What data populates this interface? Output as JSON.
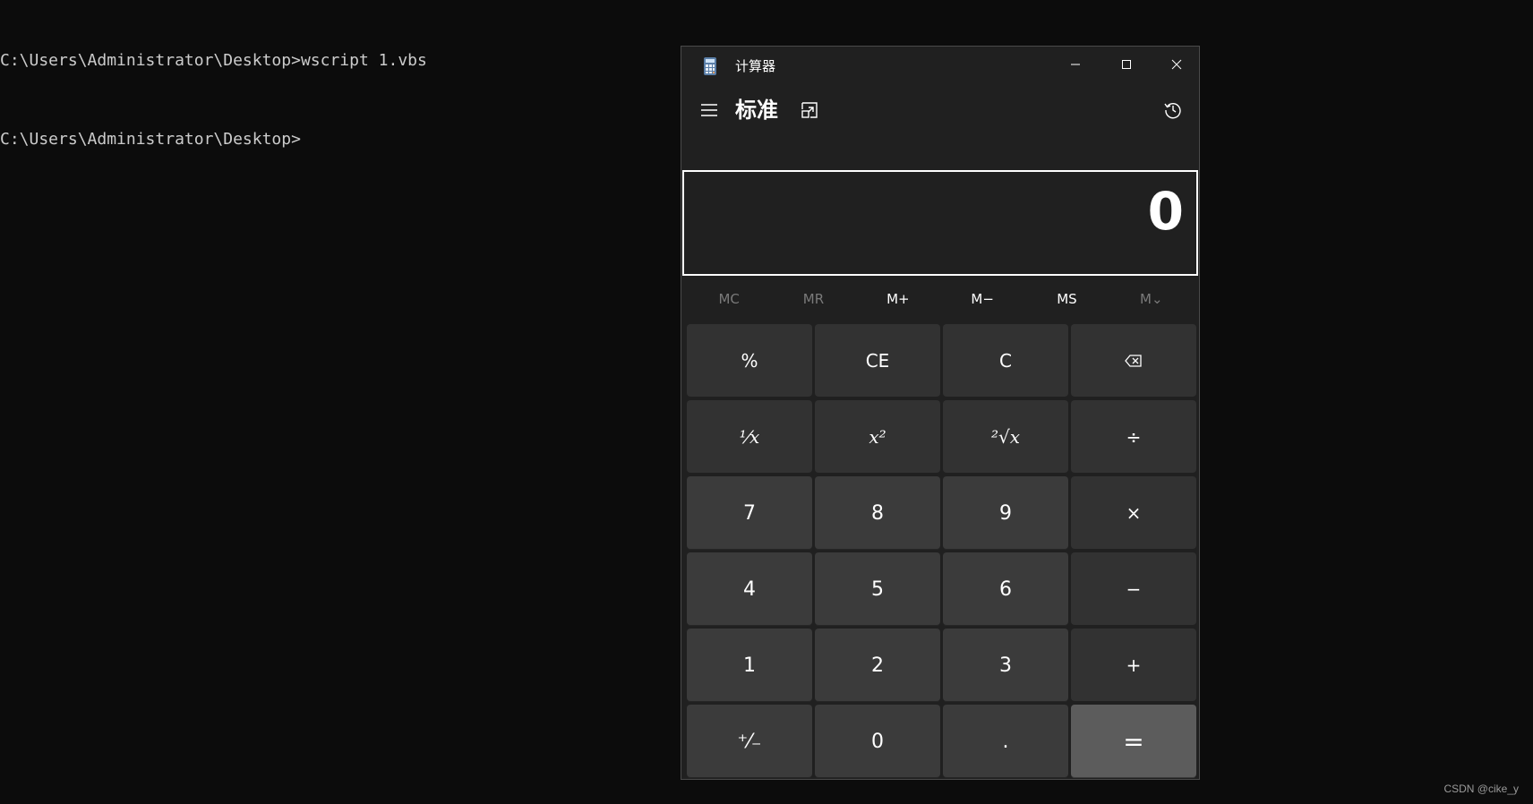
{
  "console": {
    "lines": [
      "C:\\Users\\Administrator\\Desktop>wscript 1.vbs",
      "C:\\Users\\Administrator\\Desktop>"
    ]
  },
  "calculator": {
    "title": "计算器",
    "mode": "标准",
    "display_value": "0",
    "memory": {
      "mc": "MC",
      "mr": "MR",
      "m_plus": "M+",
      "m_minus": "M−",
      "ms": "MS",
      "m_list": "M⌄"
    },
    "keys": {
      "percent": "%",
      "clear_entry": "CE",
      "clear": "C",
      "reciprocal": "¹⁄x",
      "square": "x²",
      "sqrt": "²√x",
      "divide": "÷",
      "seven": "7",
      "eight": "8",
      "nine": "9",
      "multiply": "×",
      "four": "4",
      "five": "5",
      "six": "6",
      "minus": "−",
      "one": "1",
      "two": "2",
      "three": "3",
      "plus": "+",
      "negate": "⁺⁄₋",
      "zero": "0",
      "decimal": ".",
      "equals": "="
    },
    "icons": {
      "app": "calculator-icon",
      "menu": "hamburger-icon",
      "keep_on_top": "keep-on-top-icon",
      "history": "history-icon",
      "backspace": "backspace-icon"
    }
  },
  "watermark": "CSDN @cike_y"
}
